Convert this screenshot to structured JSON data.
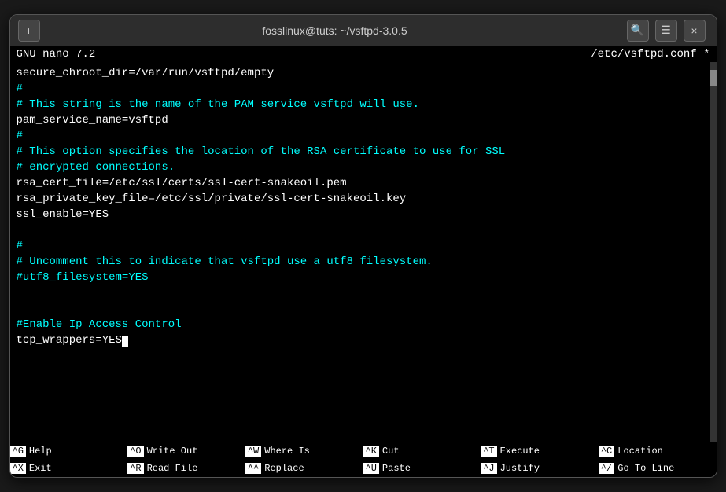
{
  "window": {
    "title": "fosslinux@tuts: ~/vsftpd-3.0.5",
    "close_label": "×",
    "add_label": "+"
  },
  "nano": {
    "version": "GNU nano 7.2",
    "filename": "/etc/vsftpd.conf *"
  },
  "content": {
    "lines": [
      {
        "text": "secure_chroot_dir=/var/run/vsftpd/empty",
        "color": "white"
      },
      {
        "text": "#",
        "color": "cyan"
      },
      {
        "text": "# This string is the name of the PAM service vsftpd will use.",
        "color": "cyan"
      },
      {
        "text": "pam_service_name=vsftpd",
        "color": "white"
      },
      {
        "text": "#",
        "color": "cyan"
      },
      {
        "text": "# This option specifies the location of the RSA certificate to use for SSL",
        "color": "cyan"
      },
      {
        "text": "# encrypted connections.",
        "color": "cyan"
      },
      {
        "text": "rsa_cert_file=/etc/ssl/certs/ssl-cert-snakeoil.pem",
        "color": "white"
      },
      {
        "text": "rsa_private_key_file=/etc/ssl/private/ssl-cert-snakeoil.key",
        "color": "white"
      },
      {
        "text": "ssl_enable=YES",
        "color": "white"
      },
      {
        "text": "",
        "color": "white"
      },
      {
        "text": "#",
        "color": "cyan"
      },
      {
        "text": "# Uncomment this to indicate that vsftpd use a utf8 filesystem.",
        "color": "cyan"
      },
      {
        "text": "#utf8_filesystem=YES",
        "color": "cyan"
      },
      {
        "text": "",
        "color": "white"
      },
      {
        "text": "",
        "color": "white"
      },
      {
        "text": "#Enable Ip Access Control",
        "color": "cyan"
      },
      {
        "text": "tcp_wrappers=YES",
        "color": "white",
        "cursor": true
      }
    ]
  },
  "shortcuts": {
    "row1": [
      {
        "key": "^G",
        "label": "Help"
      },
      {
        "key": "^O",
        "label": "Write Out"
      },
      {
        "key": "^W",
        "label": "Where Is"
      },
      {
        "key": "^K",
        "label": "Cut"
      },
      {
        "key": "^T",
        "label": "Execute"
      },
      {
        "key": "^C",
        "label": "Location"
      }
    ],
    "row2": [
      {
        "key": "^X",
        "label": "Exit"
      },
      {
        "key": "^R",
        "label": "Read File"
      },
      {
        "key": "^^",
        "label": "Replace"
      },
      {
        "key": "^U",
        "label": "Paste"
      },
      {
        "key": "^J",
        "label": "Justify"
      },
      {
        "key": "^/",
        "label": "Go To Line"
      }
    ]
  }
}
